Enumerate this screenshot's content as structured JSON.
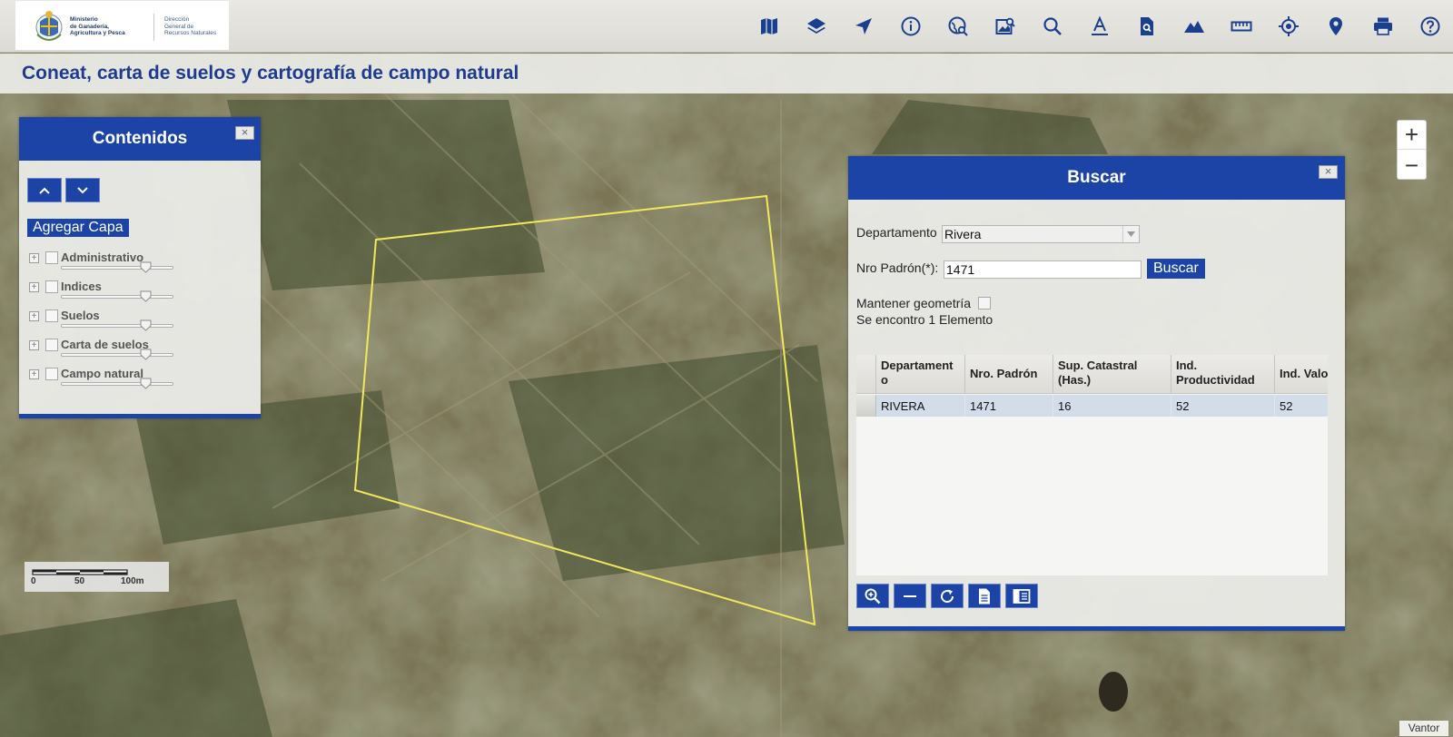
{
  "header": {
    "logo": {
      "ministry_lines": [
        "Ministerio",
        "de Ganadería,",
        "Agricultura y Pesca"
      ],
      "direction_lines": [
        "Dirección",
        "General de",
        "Recursos Naturales"
      ]
    },
    "tools": [
      {
        "icon": "map-icon"
      },
      {
        "icon": "layers-icon"
      },
      {
        "icon": "navigate-icon"
      },
      {
        "icon": "info-icon"
      },
      {
        "icon": "globe-search-icon"
      },
      {
        "icon": "image-search-icon"
      },
      {
        "icon": "search-icon"
      },
      {
        "icon": "text-tool-icon"
      },
      {
        "icon": "document-search-icon"
      },
      {
        "icon": "terrain-icon"
      },
      {
        "icon": "ruler-icon"
      },
      {
        "icon": "locate-icon"
      },
      {
        "icon": "pin-icon"
      },
      {
        "icon": "print-icon"
      },
      {
        "icon": "help-icon"
      }
    ]
  },
  "app": {
    "title": "Coneat, carta de suelos y cartografía de campo natural"
  },
  "contenidos": {
    "title": "Contenidos",
    "close": "×",
    "add_layer": "Agregar Capa",
    "layers": [
      {
        "name": "Administrativo",
        "opacity": 0.75
      },
      {
        "name": "Indices",
        "opacity": 0.75
      },
      {
        "name": "Suelos",
        "opacity": 0.75
      },
      {
        "name": "Carta de suelos",
        "opacity": 0.75
      },
      {
        "name": "Campo natural",
        "opacity": 0.75
      }
    ]
  },
  "zoom": {
    "in": "+",
    "out": "−"
  },
  "buscar": {
    "title": "Buscar",
    "close": "×",
    "departamento_label": "Departamento",
    "departamento_value": "Rivera",
    "padron_label": "Nro Padrón(*):",
    "padron_value": "1471",
    "search_button": "Buscar",
    "mantener_label": "Mantener geometría",
    "result_text": "Se encontro 1 Elemento",
    "table": {
      "headers": [
        "Departament\no",
        "Nro. Padrón",
        "Sup. Catastral\n(Has.)",
        "Ind.\nProductividad",
        "Ind. Valor"
      ],
      "rows": [
        [
          "RIVERA",
          "1471",
          "16",
          "52",
          "52"
        ]
      ]
    }
  },
  "scale": {
    "labels": [
      "0",
      "50",
      "100m"
    ]
  },
  "map": {
    "parcel_color": "#f2e85a"
  },
  "attribution": "Vantor"
}
